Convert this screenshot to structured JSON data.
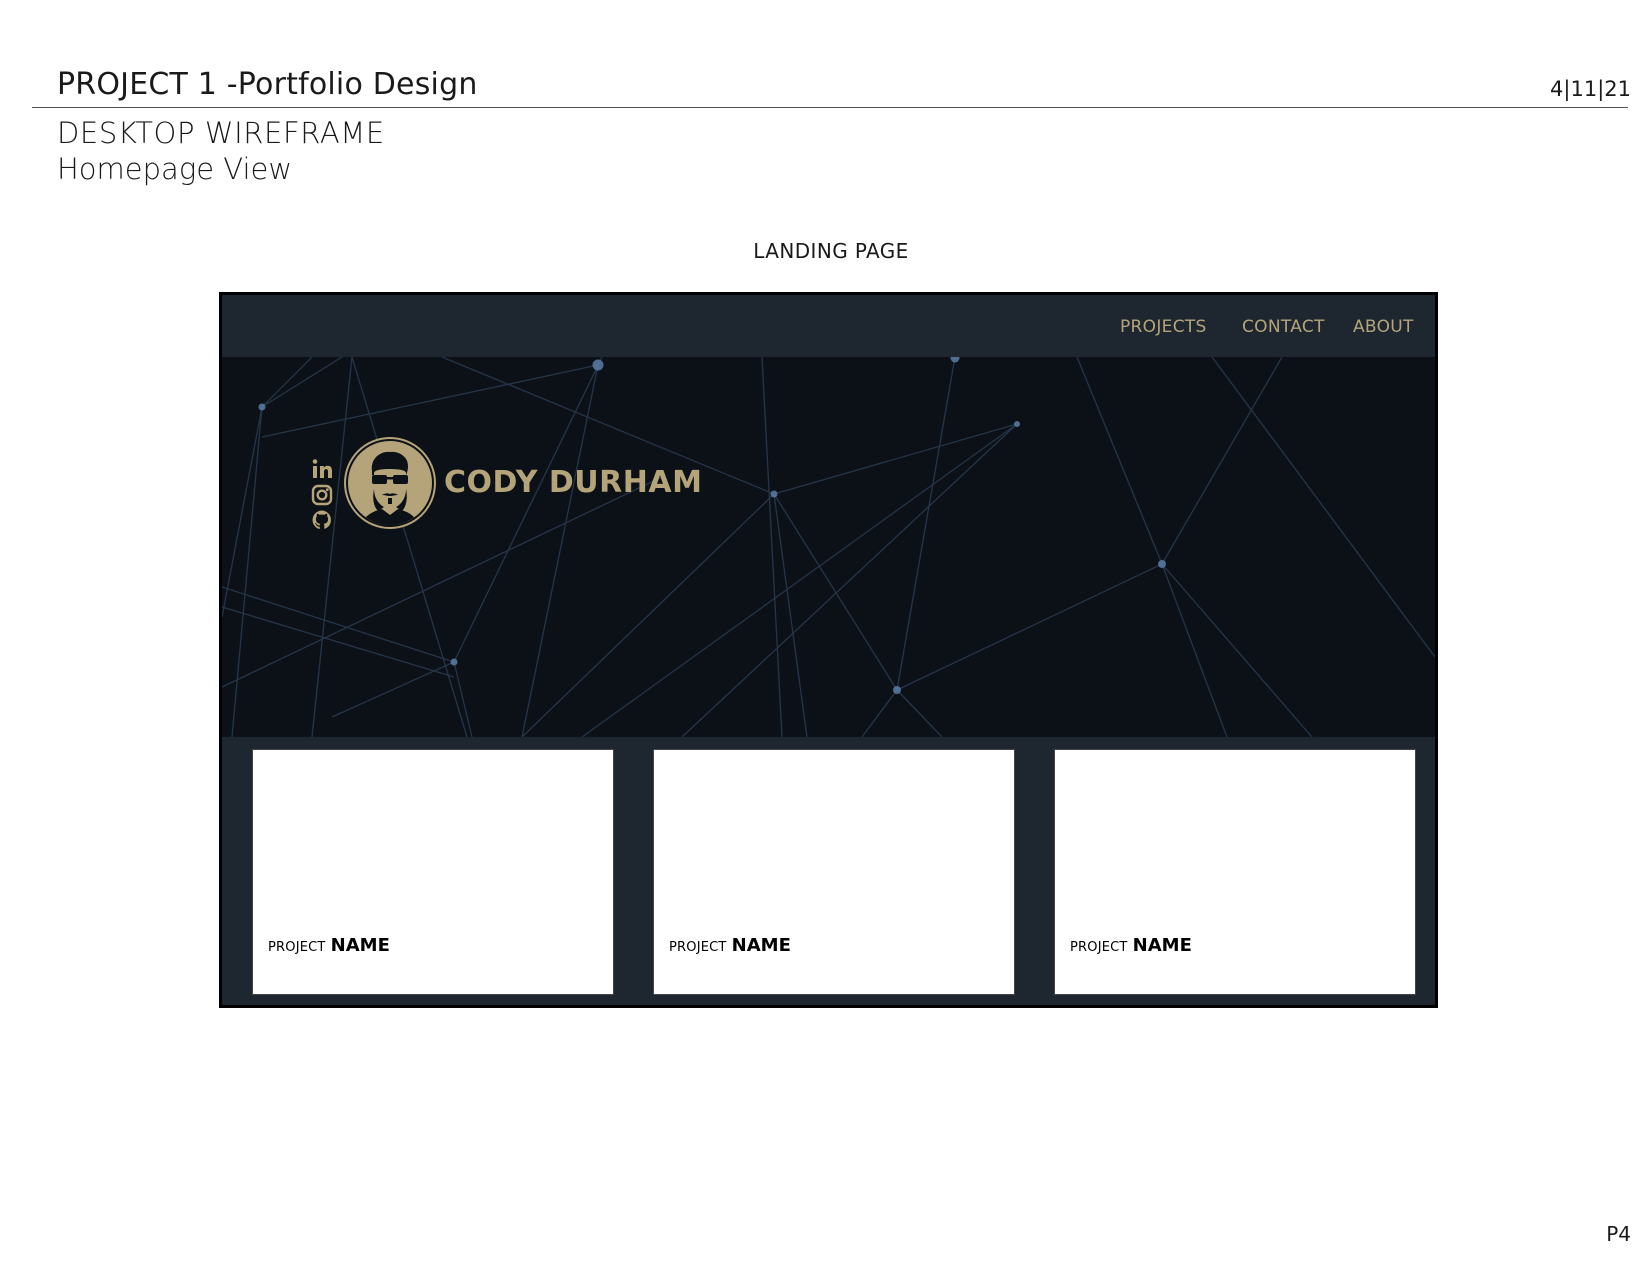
{
  "doc": {
    "title": "PROJECT 1 -Portfolio Design",
    "date": "4|11|21",
    "subtitle": "DESKTOP WIREFRAME",
    "subtitle2": "Homepage View",
    "section_label": "LANDING PAGE",
    "page_number": "P4"
  },
  "nav": {
    "items": [
      {
        "label": "PROJECTS"
      },
      {
        "label": "CONTACT"
      },
      {
        "label": "ABOUT"
      }
    ]
  },
  "hero": {
    "name": "CODY DURHAM",
    "socials": [
      {
        "icon": "linkedin-icon"
      },
      {
        "icon": "instagram-icon"
      },
      {
        "icon": "github-icon"
      }
    ]
  },
  "cards": [
    {
      "prefix": "PROJECT",
      "name": "NAME"
    },
    {
      "prefix": "PROJECT",
      "name": "NAME"
    },
    {
      "prefix": "PROJECT",
      "name": "NAME"
    }
  ],
  "colors": {
    "accent_gold": "#b5a479",
    "nav_bg": "#1e2730",
    "hero_bg": "#0c1117",
    "network_lines": "#3a5372"
  }
}
